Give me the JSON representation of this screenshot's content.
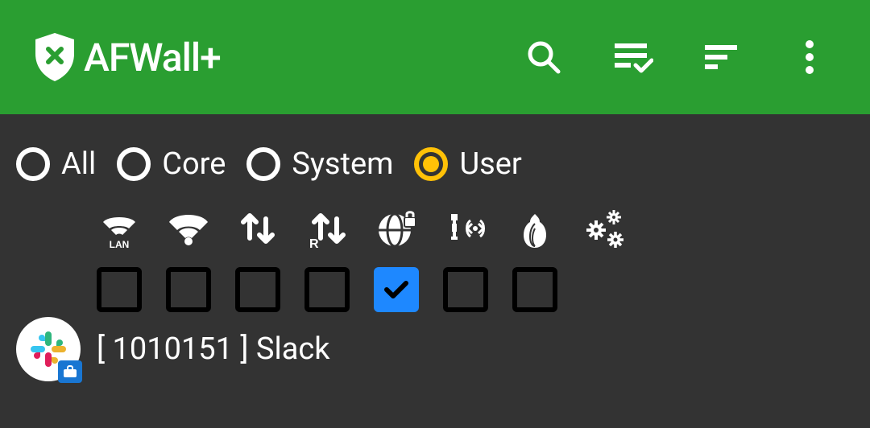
{
  "toolbar": {
    "title": "AFWall+"
  },
  "filters": {
    "options": [
      {
        "label": "All",
        "selected": false
      },
      {
        "label": "Core",
        "selected": false
      },
      {
        "label": "System",
        "selected": false
      },
      {
        "label": "User",
        "selected": true
      }
    ]
  },
  "network_columns": [
    {
      "name": "lan",
      "checked": false
    },
    {
      "name": "wifi",
      "checked": false
    },
    {
      "name": "mobile-data",
      "checked": false
    },
    {
      "name": "roaming",
      "checked": false
    },
    {
      "name": "vpn",
      "checked": true
    },
    {
      "name": "tether",
      "checked": false
    },
    {
      "name": "tor",
      "checked": false
    }
  ],
  "apps": [
    {
      "uid": "1010151",
      "name": "Slack",
      "display": "[ 1010151 ] Slack",
      "icon": "slack"
    }
  ]
}
